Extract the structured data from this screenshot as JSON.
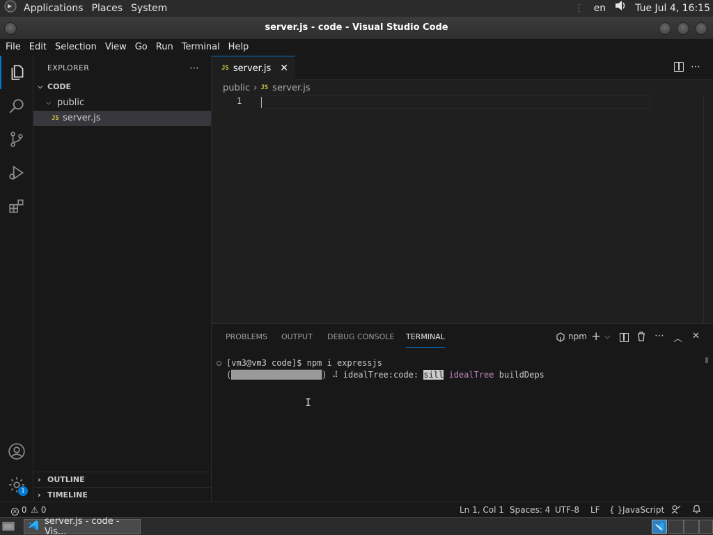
{
  "gnome": {
    "menus": [
      "Applications",
      "Places",
      "System"
    ],
    "lang": "en",
    "clock": "Tue Jul  4, 16:15"
  },
  "window": {
    "title": "server.js - code - Visual Studio Code"
  },
  "menubar": [
    "File",
    "Edit",
    "Selection",
    "View",
    "Go",
    "Run",
    "Terminal",
    "Help"
  ],
  "sidebar": {
    "header": "EXPLORER",
    "folder_root": "CODE",
    "folder_public": "public",
    "file": "server.js",
    "outline": "OUTLINE",
    "timeline": "TIMELINE"
  },
  "editor": {
    "tab_label": "server.js",
    "breadcrumb_folder": "public",
    "breadcrumb_file": "server.js",
    "line_number": "1",
    "js_badge": "JS"
  },
  "panel": {
    "tabs": [
      "PROBLEMS",
      "OUTPUT",
      "DEBUG CONSOLE",
      "TERMINAL"
    ],
    "active_tab": "TERMINAL",
    "terminal_name": "npm",
    "lines": {
      "prompt": "[vm3@vm3 code]$ npm i expressjs",
      "progress_open": "(",
      "progress_bar": "██████████████████",
      "progress_rest": ") ⠼ idealTree:code: ",
      "sill": "sill",
      "idealtree": "idealTree",
      "builddeps": "buildDeps"
    }
  },
  "status": {
    "errors": "0",
    "warnings": "0",
    "position": "Ln 1, Col 1",
    "spaces": "Spaces: 4",
    "encoding": "UTF-8",
    "eol": "LF",
    "language": "JavaScript",
    "account_badge": "1"
  },
  "taskbar": {
    "window_label": "server.js - code - Vis..."
  },
  "colors": {
    "accent": "#0078d4",
    "js_yellow": "#cbcb41",
    "purple": "#c586c0"
  }
}
